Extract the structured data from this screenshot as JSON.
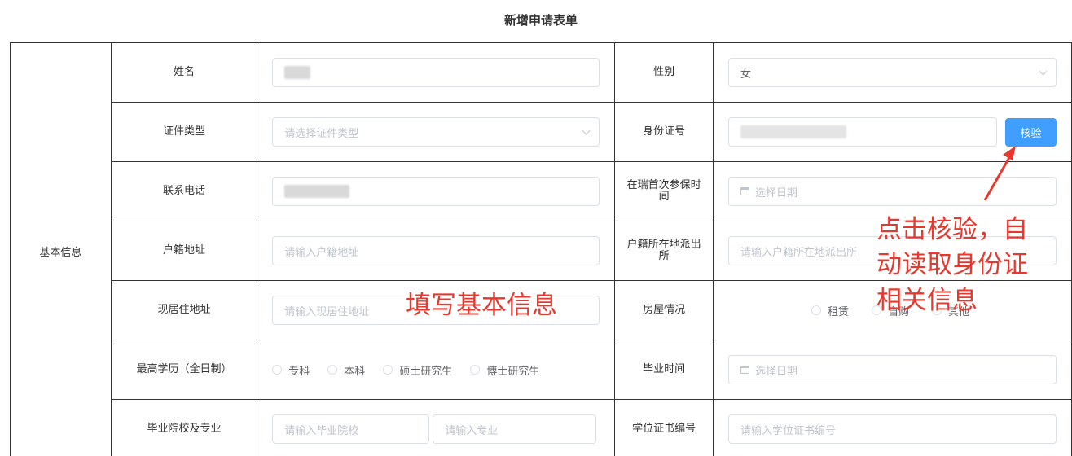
{
  "title": "新增申请表单",
  "group_label": "基本信息",
  "fields": {
    "name": {
      "label": "姓名"
    },
    "gender": {
      "label": "性别",
      "value": "女"
    },
    "id_type": {
      "label": "证件类型",
      "placeholder": "请选择证件类型"
    },
    "id_number": {
      "label": "身份证号",
      "button": "核验"
    },
    "phone": {
      "label": "联系电话"
    },
    "first_insured": {
      "label": "在瑞首次参保时间",
      "placeholder": "选择日期"
    },
    "hukou_address": {
      "label": "户籍地址",
      "placeholder": "请输入户籍地址"
    },
    "hukou_police": {
      "label": "户籍所在地派出所",
      "placeholder": "请输入户籍所在地派出所"
    },
    "current_address": {
      "label": "现居住地址",
      "placeholder": "请输入现居住地址"
    },
    "housing": {
      "label": "房屋情况",
      "options": [
        "租赁",
        "自购",
        "其他"
      ]
    },
    "education": {
      "label": "最高学历（全日制）",
      "options": [
        "专科",
        "本科",
        "硕士研究生",
        "博士研究生"
      ]
    },
    "graduation_time": {
      "label": "毕业时间",
      "placeholder": "选择日期"
    },
    "school": {
      "label": "毕业院校及专业",
      "school_placeholder": "请输入毕业院校",
      "major_placeholder": "请输入专业"
    },
    "degree_cert": {
      "label": "学位证书编号",
      "placeholder": "请输入学位证书编号"
    }
  },
  "annotations": {
    "fill_basic": "填写基本信息",
    "verify_note_1": "点击核验，自",
    "verify_note_2": "动读取身份证",
    "verify_note_3": "相关信息"
  },
  "colors": {
    "primary": "#409eff",
    "annotation": "#e8382e",
    "border": "#333333"
  }
}
